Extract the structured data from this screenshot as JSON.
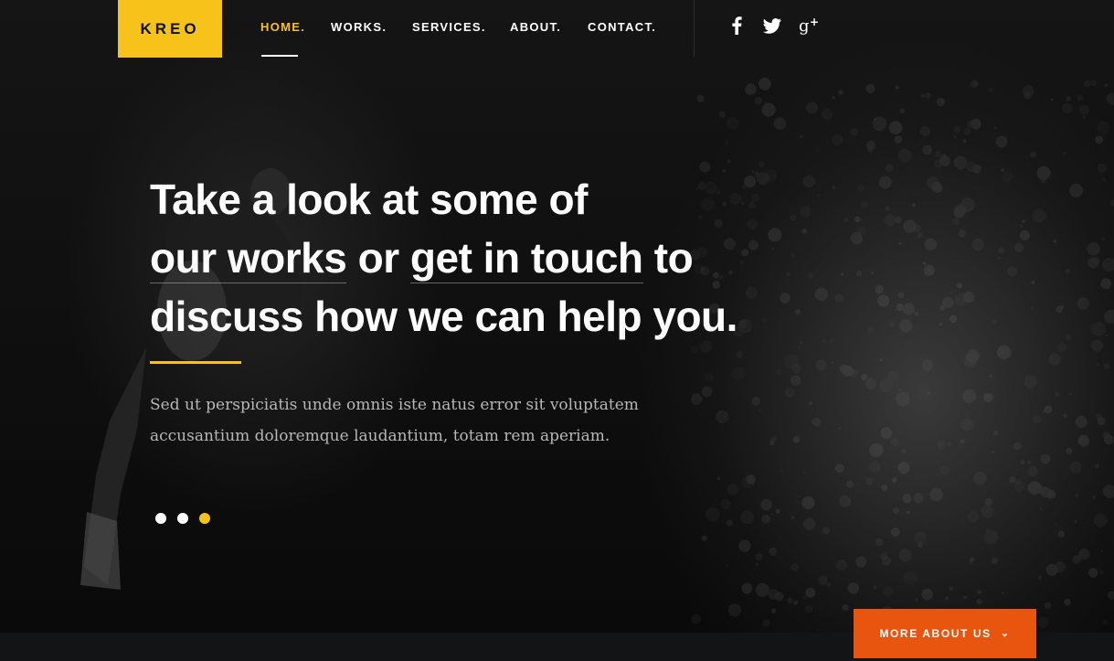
{
  "header": {
    "logo": "KREO",
    "nav": [
      {
        "label": "HOME.",
        "active": true
      },
      {
        "label": "WORKS.",
        "active": false
      },
      {
        "label": "SERVICES.",
        "active": false
      },
      {
        "label": "ABOUT.",
        "active": false
      },
      {
        "label": "CONTACT.",
        "active": false
      }
    ],
    "social": [
      "facebook-icon",
      "twitter-icon",
      "google-plus-icon"
    ]
  },
  "hero": {
    "headline": {
      "line1": "Take a look at some of",
      "line2_link1": "our works",
      "line2_mid": " or ",
      "line2_link2": "get in touch",
      "line2_end": " to",
      "line3": "discuss how we can help you."
    },
    "lead": {
      "line1": "Sed ut perspiciatis unde omnis iste natus error sit voluptatem",
      "line2": "accusantium doloremque laudantium, totam rem aperiam."
    },
    "slider": {
      "count": 3,
      "active_index": 2
    },
    "cta": {
      "label": "MORE ABOUT US",
      "icon": "chevron-down-icon"
    }
  },
  "colors": {
    "accent": "#f7c21a",
    "cta": "#e8550e",
    "background": "#0b0b0c"
  }
}
